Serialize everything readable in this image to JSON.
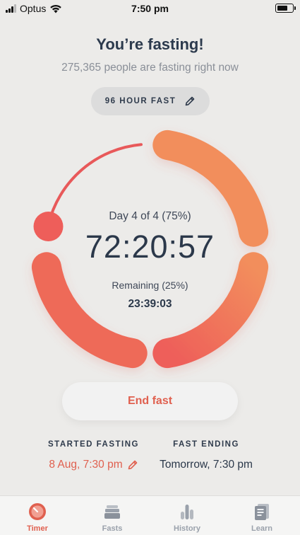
{
  "status_bar": {
    "carrier": "Optus",
    "time": "7:50 pm"
  },
  "header": {
    "title": "You’re fasting!",
    "subtitle": "275,365 people are fasting right now"
  },
  "plan": {
    "label": "96 HOUR FAST",
    "edit_icon": "pencil-icon"
  },
  "timer": {
    "day_label": "Day 4 of 4 (75%)",
    "elapsed": "72:20:57",
    "remaining_label": "Remaining (25%)",
    "remaining": "23:39:03",
    "progress": 0.75,
    "colors": {
      "start": "#ee5e5a",
      "end": "#f28e5b"
    }
  },
  "actions": {
    "end_fast": "End fast"
  },
  "details": {
    "started_heading": "STARTED FASTING",
    "started_value": "8 Aug, 7:30 pm",
    "ending_heading": "FAST ENDING",
    "ending_value": "Tomorrow, 7:30 pm"
  },
  "tabs": [
    {
      "label": "Timer",
      "icon": "timer-icon",
      "active": true
    },
    {
      "label": "Fasts",
      "icon": "fasts-icon",
      "active": false
    },
    {
      "label": "History",
      "icon": "history-icon",
      "active": false
    },
    {
      "label": "Learn",
      "icon": "learn-icon",
      "active": false
    }
  ]
}
